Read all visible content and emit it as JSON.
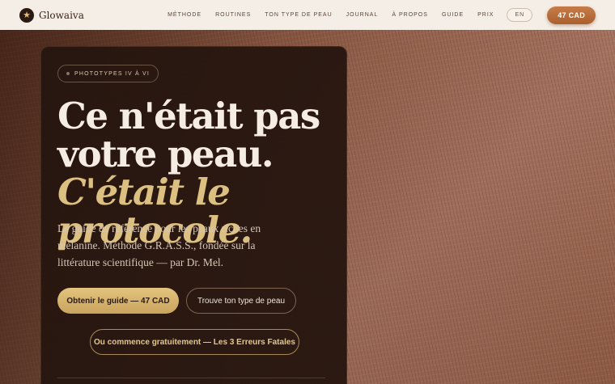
{
  "brand": {
    "logo_icon": "star-icon",
    "name": "Glowaiva"
  },
  "nav": {
    "items": [
      {
        "label": "Méthode"
      },
      {
        "label": "Routines"
      },
      {
        "label": "Ton type de peau"
      },
      {
        "label": "Journal"
      },
      {
        "label": "À propos"
      },
      {
        "label": "Guide"
      },
      {
        "label": "Prix"
      }
    ],
    "lang": "EN",
    "cta": "47 CAD"
  },
  "hero": {
    "eyebrow": "PHOTOTYPES IV À VI",
    "headline_line1": "Ce n'était pas",
    "headline_line2": "votre peau.",
    "headline_accent": "C'était le protocole.",
    "subtitle": "Le guide de référence pour les peaux riches en mélanine. Méthode G.R.A.S.S., fondée sur la littérature scientifique — par Dr. Mel.",
    "primary_cta": "Obtenir le guide — 47 CAD",
    "secondary_cta": "Trouve ton type de peau",
    "free_cta": "Ou commence gratuitement — Les 3 Erreurs Fatales"
  },
  "colors": {
    "accent_gold": "#dcc082",
    "brand_copper": "#b96a38",
    "card_bg": "#26160f",
    "header_bg": "#f4eee6"
  }
}
